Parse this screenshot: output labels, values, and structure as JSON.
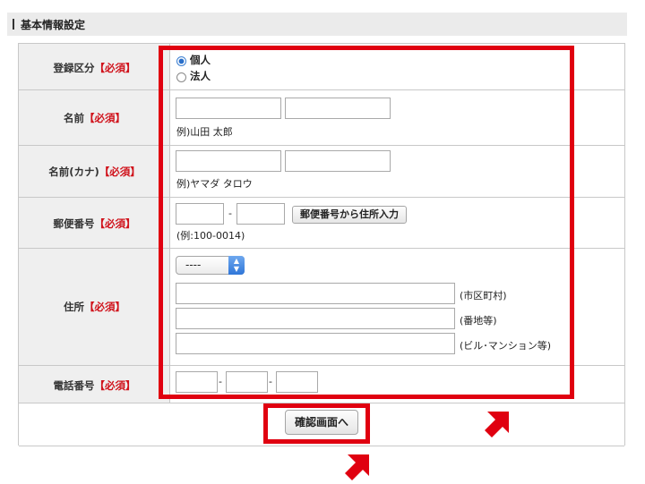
{
  "section": {
    "title": "基本情報設定"
  },
  "required_mark": "【必須】",
  "rows": {
    "kubun": {
      "label": "登録区分",
      "options": [
        "個人",
        "法人"
      ],
      "selected": "個人"
    },
    "name": {
      "label": "名前",
      "example": "例)山田 太郎"
    },
    "kana": {
      "label": "名前(カナ)",
      "example": "例)ヤマダ タロウ"
    },
    "zip": {
      "label": "郵便番号",
      "separator": "-",
      "button": "郵便番号から住所入力",
      "example": "(例:100-0014)"
    },
    "address": {
      "label": "住所",
      "prefecture_value": "----",
      "field_labels": [
        "(市区町村)",
        "(番地等)",
        "(ビル･マンション等)"
      ]
    },
    "tel": {
      "label": "電話番号",
      "separators": [
        "-",
        "-"
      ]
    }
  },
  "submit_label": "確認画面へ",
  "colors": {
    "highlight": "#e00010",
    "required": "#d0121b",
    "label_bg": "#efefef"
  }
}
